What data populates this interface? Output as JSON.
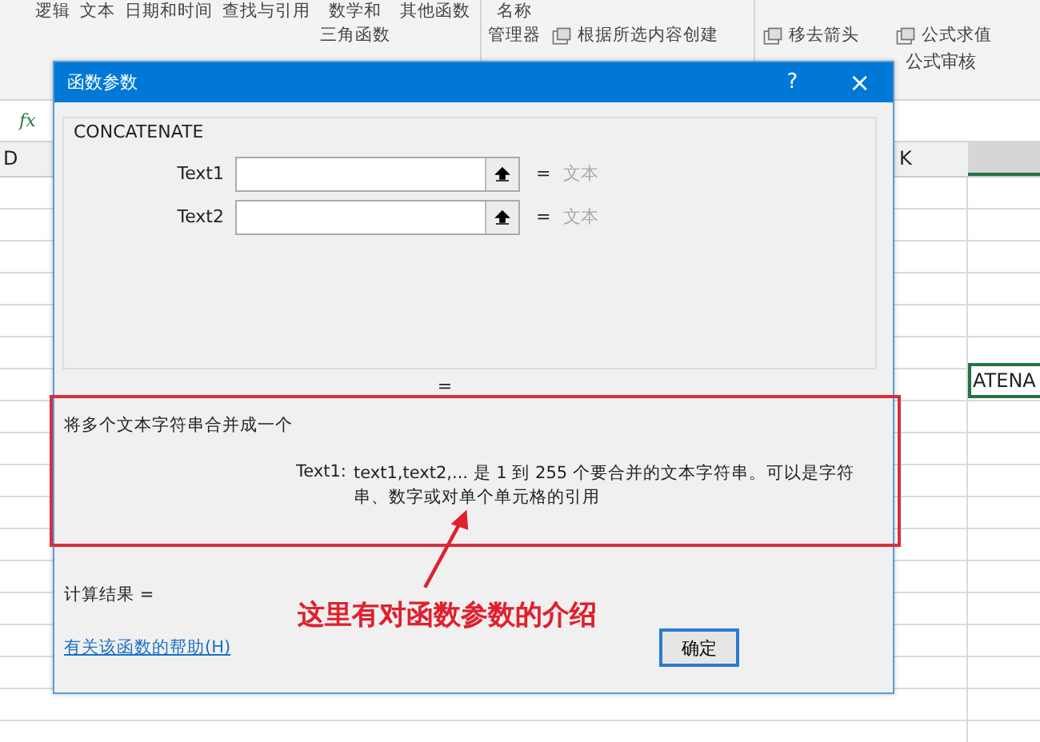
{
  "ribbon": {
    "items": [
      {
        "lines": [
          "逻辑"
        ],
        "icon": false
      },
      {
        "lines": [
          "文本"
        ],
        "icon": false
      },
      {
        "lines": [
          "日期和时间"
        ],
        "icon": false
      },
      {
        "lines": [
          "查找与引用"
        ],
        "icon": false
      },
      {
        "lines": [
          "数学和",
          "三角函数"
        ],
        "icon": false
      },
      {
        "lines": [
          "其他函数"
        ],
        "icon": false
      },
      {
        "lines": [
          "名称",
          "管理器"
        ],
        "icon": false
      },
      {
        "lines": [
          "根据所选内容创建"
        ],
        "icon": true
      },
      {
        "lines": [
          "移去箭头"
        ],
        "icon": true
      },
      {
        "lines": [
          "公式求值"
        ],
        "icon": true
      }
    ],
    "groups": [
      "公式审核"
    ]
  },
  "formula_bar": {
    "fx": "fx"
  },
  "sheet": {
    "columns": [
      "D",
      "K"
    ],
    "active_cell": "ATENA"
  },
  "dialog": {
    "title": "函数参数",
    "help": "?",
    "close": "×",
    "function_name": "CONCATENATE",
    "args": [
      {
        "label": "Text1",
        "equals": "=",
        "value": "文本"
      },
      {
        "label": "Text2",
        "equals": "=",
        "value": "文本"
      }
    ],
    "result_equals": "=",
    "description": "将多个文本字符串合并成一个",
    "arg_name": "Text1:",
    "arg_help": "text1,text2,... 是 1 到 255 个要合并的文本字符串。可以是字符串、数字或对单个单元格的引用",
    "result_label": "计算结果 =",
    "help_link": "有关该函数的帮助(H)",
    "ok": "确定"
  },
  "annotation": "这里有对函数参数的介绍"
}
